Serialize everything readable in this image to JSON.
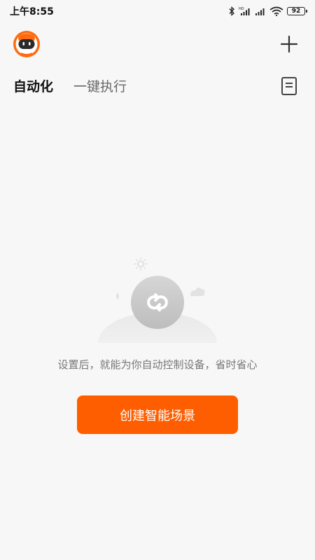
{
  "status_bar": {
    "time": "上午8:55",
    "battery_level": "92",
    "icons": [
      "bluetooth-icon",
      "signal-hd-icon",
      "signal-icon",
      "wifi-icon",
      "battery-icon"
    ]
  },
  "header": {
    "avatar_icon": "robot-avatar-icon",
    "add_icon": "plus-icon"
  },
  "tabs": {
    "items": [
      {
        "label": "自动化",
        "active": true
      },
      {
        "label": "一键执行",
        "active": false
      }
    ],
    "log_icon": "document-icon"
  },
  "empty_state": {
    "illustration_icon": "loop-icon",
    "message": "设置后，就能为你自动控制设备，省时省心"
  },
  "primary_action": {
    "label": "创建智能场景"
  },
  "colors": {
    "accent": "#ff5e00",
    "background": "#f7f7f7",
    "text_primary": "#111111",
    "text_secondary": "#777777"
  }
}
